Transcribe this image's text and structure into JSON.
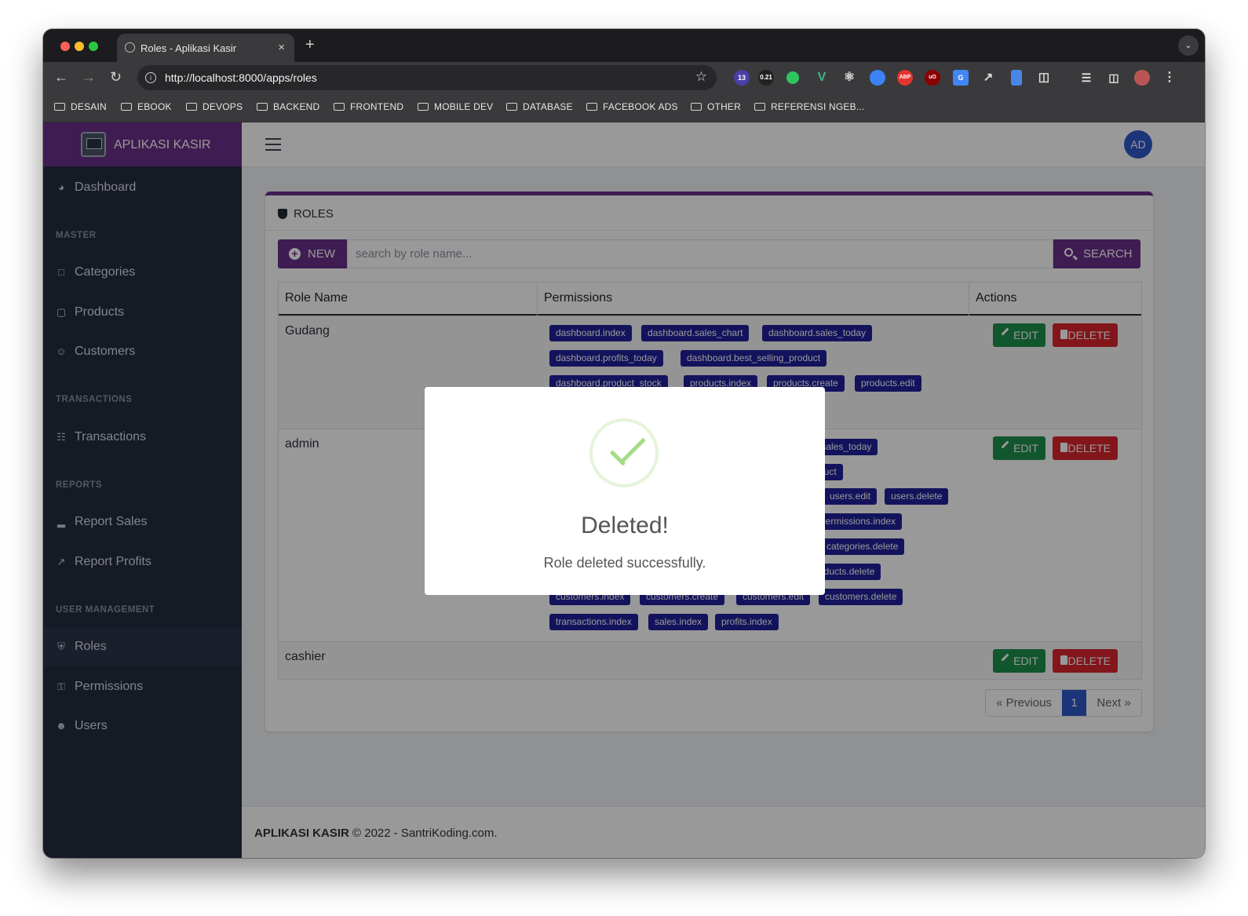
{
  "browser": {
    "tab_title": "Roles - Aplikasi Kasir",
    "tab_close": "×",
    "new_tab": "+",
    "url": "http://localhost:8000/apps/roles",
    "ext_badge_count": "13",
    "ext_badge_value": "0.21",
    "bookmarks": [
      "DESAIN",
      "EBOOK",
      "DEVOPS",
      "BACKEND",
      "FRONTEND",
      "MOBILE DEV",
      "DATABASE",
      "FACEBOOK ADS",
      "OTHER",
      "REFERENSI NGEB..."
    ]
  },
  "sidebar": {
    "brand": "APLIKASI KASIR",
    "dashboard": "Dashboard",
    "header_master": "MASTER",
    "categories": "Categories",
    "products": "Products",
    "customers": "Customers",
    "header_transactions": "TRANSACTIONS",
    "transactions": "Transactions",
    "header_reports": "REPORTS",
    "report_sales": "Report Sales",
    "report_profits": "Report Profits",
    "header_user_management": "USER MANAGEMENT",
    "roles": "Roles",
    "permissions": "Permissions",
    "users": "Users"
  },
  "header": {
    "avatar_initials": "AD"
  },
  "card": {
    "title": "ROLES",
    "new_label": "NEW",
    "search_placeholder": "search by role name...",
    "search_label": "SEARCH"
  },
  "table": {
    "col_role": "Role Name",
    "col_permissions": "Permissions",
    "col_actions": "Actions",
    "edit_label": "EDIT",
    "delete_label": "DELETE",
    "rows": [
      {
        "name": "Gudang",
        "permissions": [
          "dashboard.index",
          "dashboard.sales_chart",
          "dashboard.sales_today",
          "dashboard.profits_today",
          "dashboard.best_selling_product",
          "dashboard.product_stock",
          "products.index",
          "products.create",
          "products.edit"
        ]
      },
      {
        "name": "admin",
        "permissions": [
          ".sales_today",
          "duct",
          "users.edit",
          "users.delete",
          "permissions.index",
          "categories.delete",
          "oducts.delete",
          "customers.index",
          "customers.create",
          "customers.edit",
          "customers.delete",
          "transactions.index",
          "sales.index",
          "profits.index"
        ]
      },
      {
        "name": "cashier",
        "permissions": []
      }
    ]
  },
  "pagination": {
    "previous": "« Previous",
    "current": "1",
    "next": "Next »"
  },
  "footer": {
    "brand": "APLIKASI KASIR",
    "text": "© 2022 - SantriKoding.com."
  },
  "modal": {
    "title": "Deleted!",
    "text": "Role deleted successfully."
  },
  "colors": {
    "brand_purple": "#6a2f87",
    "badge_blue": "#20209c",
    "edit_green": "#1e8f4e",
    "delete_red": "#d9262e",
    "sidebar_bg": "#232c3e"
  }
}
